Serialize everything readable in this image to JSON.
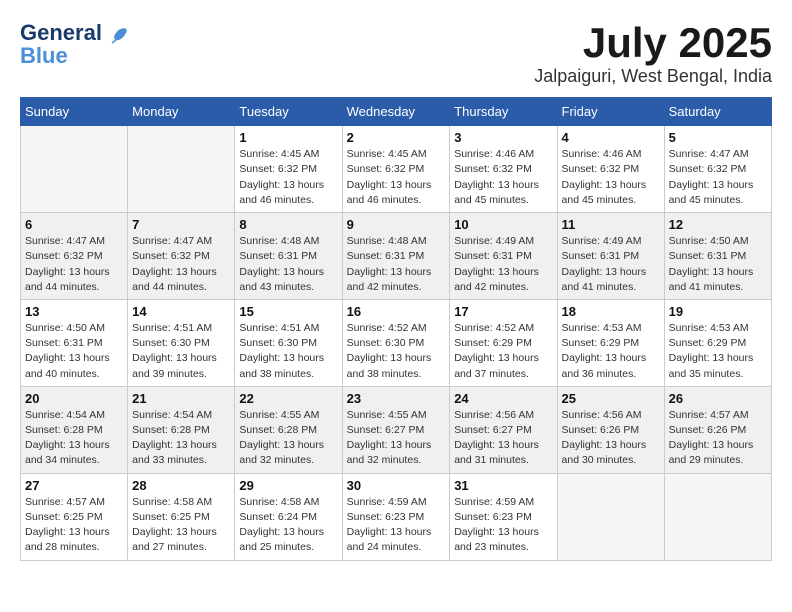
{
  "header": {
    "logo_line1": "General",
    "logo_line2": "Blue",
    "month": "July 2025",
    "location": "Jalpaiguri, West Bengal, India"
  },
  "weekdays": [
    "Sunday",
    "Monday",
    "Tuesday",
    "Wednesday",
    "Thursday",
    "Friday",
    "Saturday"
  ],
  "weeks": [
    [
      {
        "day": "",
        "info": ""
      },
      {
        "day": "",
        "info": ""
      },
      {
        "day": "1",
        "info": "Sunrise: 4:45 AM\nSunset: 6:32 PM\nDaylight: 13 hours and 46 minutes."
      },
      {
        "day": "2",
        "info": "Sunrise: 4:45 AM\nSunset: 6:32 PM\nDaylight: 13 hours and 46 minutes."
      },
      {
        "day": "3",
        "info": "Sunrise: 4:46 AM\nSunset: 6:32 PM\nDaylight: 13 hours and 45 minutes."
      },
      {
        "day": "4",
        "info": "Sunrise: 4:46 AM\nSunset: 6:32 PM\nDaylight: 13 hours and 45 minutes."
      },
      {
        "day": "5",
        "info": "Sunrise: 4:47 AM\nSunset: 6:32 PM\nDaylight: 13 hours and 45 minutes."
      }
    ],
    [
      {
        "day": "6",
        "info": "Sunrise: 4:47 AM\nSunset: 6:32 PM\nDaylight: 13 hours and 44 minutes."
      },
      {
        "day": "7",
        "info": "Sunrise: 4:47 AM\nSunset: 6:32 PM\nDaylight: 13 hours and 44 minutes."
      },
      {
        "day": "8",
        "info": "Sunrise: 4:48 AM\nSunset: 6:31 PM\nDaylight: 13 hours and 43 minutes."
      },
      {
        "day": "9",
        "info": "Sunrise: 4:48 AM\nSunset: 6:31 PM\nDaylight: 13 hours and 42 minutes."
      },
      {
        "day": "10",
        "info": "Sunrise: 4:49 AM\nSunset: 6:31 PM\nDaylight: 13 hours and 42 minutes."
      },
      {
        "day": "11",
        "info": "Sunrise: 4:49 AM\nSunset: 6:31 PM\nDaylight: 13 hours and 41 minutes."
      },
      {
        "day": "12",
        "info": "Sunrise: 4:50 AM\nSunset: 6:31 PM\nDaylight: 13 hours and 41 minutes."
      }
    ],
    [
      {
        "day": "13",
        "info": "Sunrise: 4:50 AM\nSunset: 6:31 PM\nDaylight: 13 hours and 40 minutes."
      },
      {
        "day": "14",
        "info": "Sunrise: 4:51 AM\nSunset: 6:30 PM\nDaylight: 13 hours and 39 minutes."
      },
      {
        "day": "15",
        "info": "Sunrise: 4:51 AM\nSunset: 6:30 PM\nDaylight: 13 hours and 38 minutes."
      },
      {
        "day": "16",
        "info": "Sunrise: 4:52 AM\nSunset: 6:30 PM\nDaylight: 13 hours and 38 minutes."
      },
      {
        "day": "17",
        "info": "Sunrise: 4:52 AM\nSunset: 6:29 PM\nDaylight: 13 hours and 37 minutes."
      },
      {
        "day": "18",
        "info": "Sunrise: 4:53 AM\nSunset: 6:29 PM\nDaylight: 13 hours and 36 minutes."
      },
      {
        "day": "19",
        "info": "Sunrise: 4:53 AM\nSunset: 6:29 PM\nDaylight: 13 hours and 35 minutes."
      }
    ],
    [
      {
        "day": "20",
        "info": "Sunrise: 4:54 AM\nSunset: 6:28 PM\nDaylight: 13 hours and 34 minutes."
      },
      {
        "day": "21",
        "info": "Sunrise: 4:54 AM\nSunset: 6:28 PM\nDaylight: 13 hours and 33 minutes."
      },
      {
        "day": "22",
        "info": "Sunrise: 4:55 AM\nSunset: 6:28 PM\nDaylight: 13 hours and 32 minutes."
      },
      {
        "day": "23",
        "info": "Sunrise: 4:55 AM\nSunset: 6:27 PM\nDaylight: 13 hours and 32 minutes."
      },
      {
        "day": "24",
        "info": "Sunrise: 4:56 AM\nSunset: 6:27 PM\nDaylight: 13 hours and 31 minutes."
      },
      {
        "day": "25",
        "info": "Sunrise: 4:56 AM\nSunset: 6:26 PM\nDaylight: 13 hours and 30 minutes."
      },
      {
        "day": "26",
        "info": "Sunrise: 4:57 AM\nSunset: 6:26 PM\nDaylight: 13 hours and 29 minutes."
      }
    ],
    [
      {
        "day": "27",
        "info": "Sunrise: 4:57 AM\nSunset: 6:25 PM\nDaylight: 13 hours and 28 minutes."
      },
      {
        "day": "28",
        "info": "Sunrise: 4:58 AM\nSunset: 6:25 PM\nDaylight: 13 hours and 27 minutes."
      },
      {
        "day": "29",
        "info": "Sunrise: 4:58 AM\nSunset: 6:24 PM\nDaylight: 13 hours and 25 minutes."
      },
      {
        "day": "30",
        "info": "Sunrise: 4:59 AM\nSunset: 6:23 PM\nDaylight: 13 hours and 24 minutes."
      },
      {
        "day": "31",
        "info": "Sunrise: 4:59 AM\nSunset: 6:23 PM\nDaylight: 13 hours and 23 minutes."
      },
      {
        "day": "",
        "info": ""
      },
      {
        "day": "",
        "info": ""
      }
    ]
  ]
}
